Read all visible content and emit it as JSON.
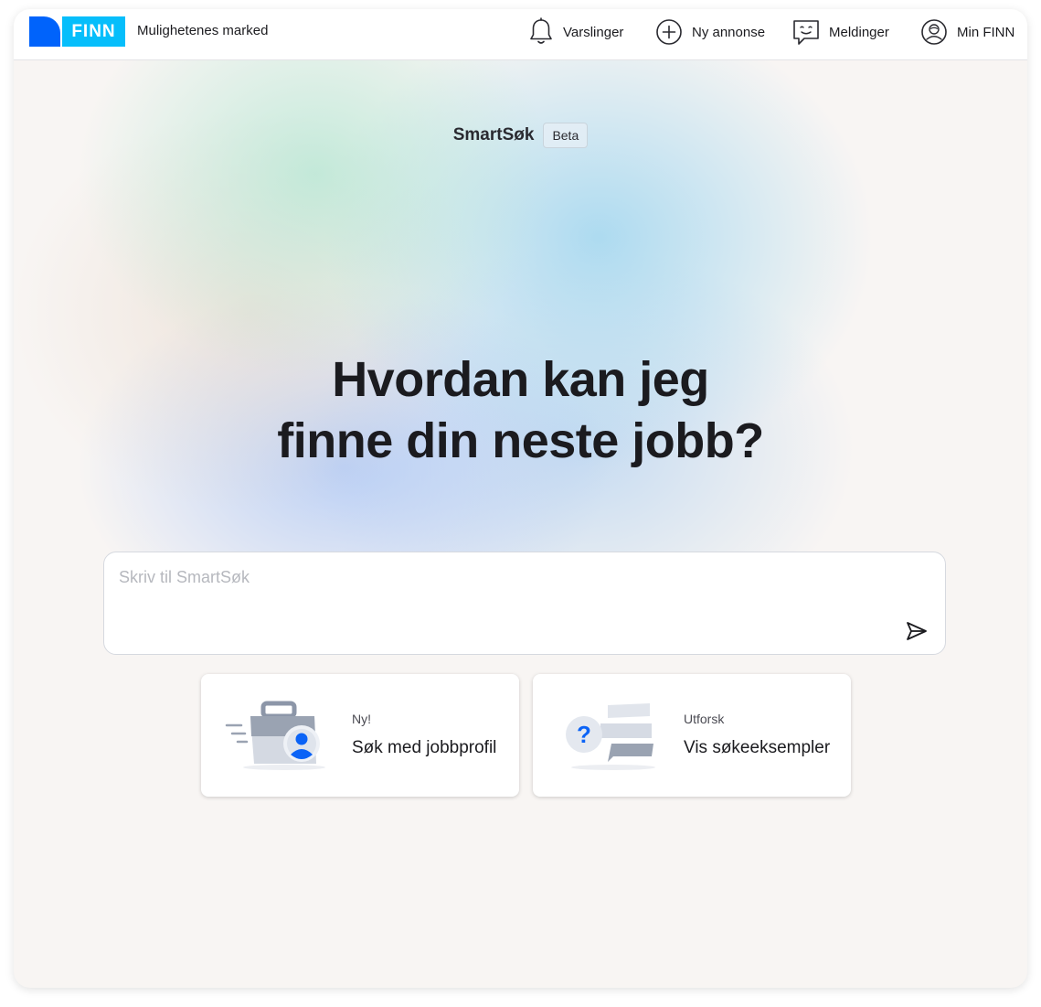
{
  "header": {
    "logo_text": "FINN",
    "tagline": "Mulighetenes marked",
    "nav": {
      "alerts": "Varslinger",
      "new_ad": "Ny annonse",
      "messages": "Meldinger",
      "my_finn": "Min FINN"
    }
  },
  "hero": {
    "product_name": "SmartSøk",
    "badge": "Beta",
    "headline_line1": "Hvordan kan jeg",
    "headline_line2": "finne din neste jobb?"
  },
  "search": {
    "placeholder": "Skriv til SmartSøk",
    "value": ""
  },
  "cards": [
    {
      "kicker": "Ny!",
      "title": "Søk med jobbprofil",
      "icon": "briefcase-profile-icon"
    },
    {
      "kicker": "Utforsk",
      "title": "Vis søkeeksempler",
      "icon": "question-chat-icon"
    }
  ],
  "colors": {
    "brand_blue": "#0063fb",
    "brand_cyan": "#06befb",
    "accent_blue": "#0b63f6"
  }
}
